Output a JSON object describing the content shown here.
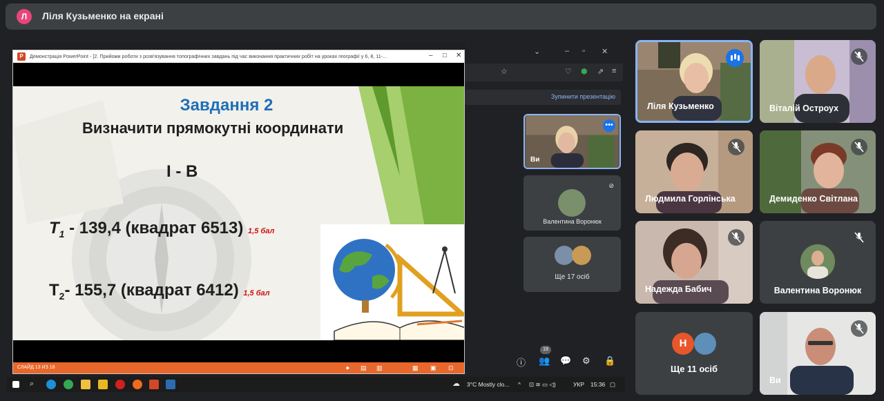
{
  "top_bar": {
    "avatar_letter": "Л",
    "presenting_text": "Ліля Кузьменко на екрані"
  },
  "ppt": {
    "title": "Демонстрація PowerPoint - [2. Прийоми роботи з розв'язування топографічних завдань під час виконання практичних робіт на уроках географії у 6, 8, 11-...",
    "icon_letter": "P",
    "window_controls": [
      "–",
      "□",
      "✕"
    ],
    "status_text": "СЛАЙД 13 ИЗ 18",
    "status_controls": [
      "⏺",
      "▤",
      "▥",
      "▦",
      "▣",
      "⊡"
    ]
  },
  "slide": {
    "title": "Завдання 2",
    "subtitle": "Визначити прямокутні координати",
    "variant": "І - В",
    "line1": {
      "sym": "Т",
      "sub": "1",
      "text": "  - 139,4 (квадрат 6513)",
      "score": "1,5 бал"
    },
    "line2": {
      "sym": "Т",
      "sub": "2",
      "text": "- 155,7 (квадрат 6412)",
      "score": "1,5 бал"
    }
  },
  "background_browser": {
    "tab_controls": [
      "⌄",
      "–",
      "▫",
      "✕"
    ],
    "stop_button": "Зупинити презентацію",
    "self_tile_label": "Ви",
    "mini_tile_name": "Валентина Воронюк",
    "mini_more_label": "Ще 17 осіб",
    "mini_badge": "19"
  },
  "participants": [
    {
      "name": "Ліля Кузьменко",
      "speaking": true
    },
    {
      "name": "Віталій Остроух",
      "muted": true
    },
    {
      "name": "Людмила Горлінська",
      "muted": true
    },
    {
      "name": "Демиденко Світлана",
      "muted": true
    },
    {
      "name": "Надежда Бабич",
      "muted": true
    },
    {
      "name": "Валентина Воронюк",
      "muted": true
    },
    {
      "name": "Ще 11 осіб",
      "avatar_letter": "Н"
    },
    {
      "name": "Ви",
      "muted": true
    }
  ],
  "taskbar": {
    "weather": "3°C  Mostly clo...",
    "lang": "УКР",
    "time": "15:36"
  },
  "colors": {
    "accent": "#8ab4f8",
    "speaking_blue": "#1a73e8",
    "slide_title_blue": "#1e6fb8",
    "score_red": "#d01010",
    "ppt_orange": "#e8672a"
  }
}
